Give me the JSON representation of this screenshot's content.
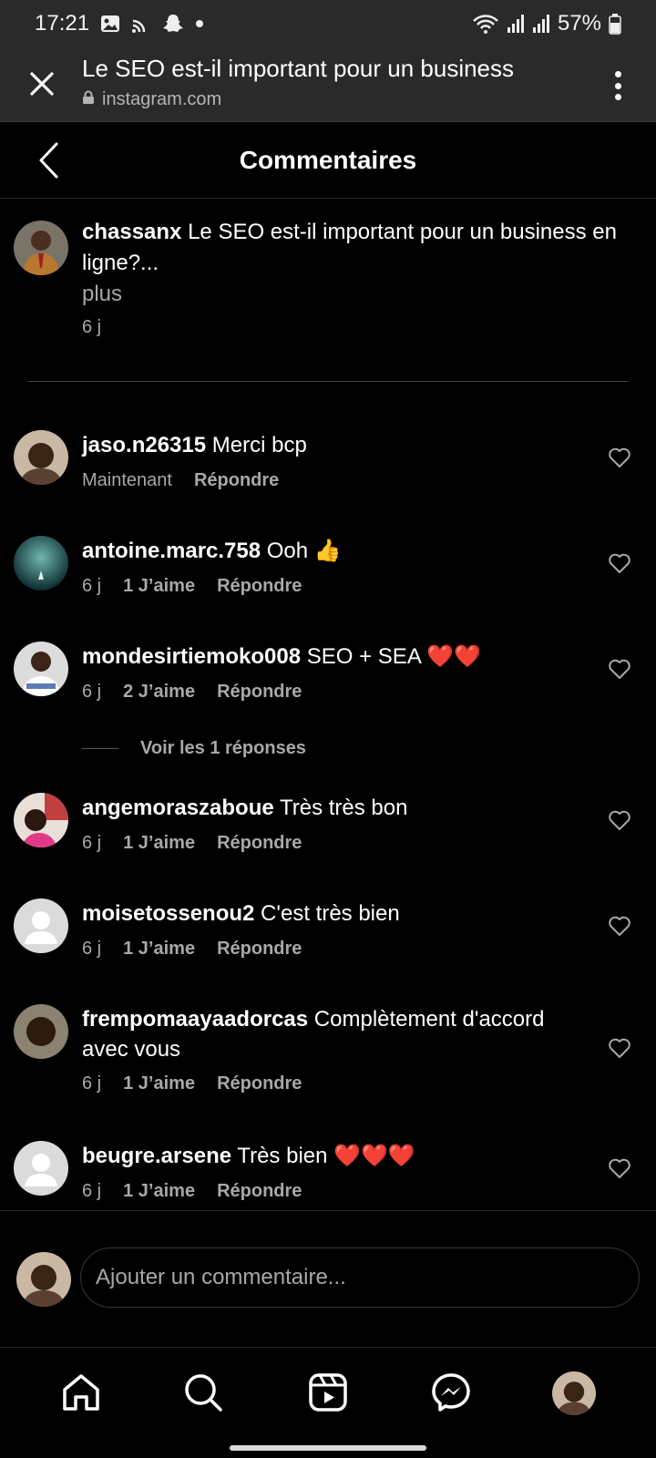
{
  "status": {
    "time": "17:21",
    "battery": "57%"
  },
  "browser": {
    "title": "Le SEO est-il important pour un business",
    "url": "instagram.com"
  },
  "header": {
    "title": "Commentaires"
  },
  "caption": {
    "username": "chassanx",
    "text": " Le SEO est-il important pour un business en ligne?...",
    "more": "plus",
    "age": "6 j"
  },
  "comments": [
    {
      "username": "jaso.n26315",
      "text": " Merci bcp",
      "age": "Maintenant",
      "likes": "",
      "reply": "Répondre"
    },
    {
      "username": "antoine.marc.758",
      "text": " Ooh 👍",
      "age": "6 j",
      "likes": "1 J’aime",
      "reply": "Répondre"
    },
    {
      "username": "mondesirtiemoko008",
      "text": " SEO + SEA ❤️❤️",
      "age": "6 j",
      "likes": "2 J’aime",
      "reply": "Répondre"
    },
    {
      "username": "angemoraszaboue",
      "text": " Très très bon",
      "age": "6 j",
      "likes": "1 J’aime",
      "reply": "Répondre"
    },
    {
      "username": "moisetossenou2",
      "text": " C'est très bien",
      "age": "6 j",
      "likes": "1 J’aime",
      "reply": "Répondre"
    },
    {
      "username": "frempomaayaadorcas",
      "text": " Complètement d'accord avec vous",
      "age": "6 j",
      "likes": "1 J’aime",
      "reply": "Répondre"
    },
    {
      "username": "beugre.arsene",
      "text": " Très bien ❤️❤️❤️",
      "age": "6 j",
      "likes": "1 J’aime",
      "reply": "Répondre"
    }
  ],
  "view_replies": "Voir les 1 réponses",
  "composer": {
    "placeholder": "Ajouter un commentaire..."
  },
  "icons": {
    "status_left": [
      "image-icon",
      "cast-icon",
      "snapchat-icon",
      "dot-icon"
    ],
    "status_right": [
      "wifi-icon",
      "signal-icon",
      "signal-icon",
      "battery-icon"
    ],
    "nav": [
      "home-icon",
      "search-icon",
      "reels-icon",
      "messenger-icon",
      "profile-avatar"
    ]
  },
  "colors": {
    "background": "#000000",
    "bar": "#2a2a2a",
    "muted": "#a8a8a8",
    "heart": "#ff1e3c"
  }
}
